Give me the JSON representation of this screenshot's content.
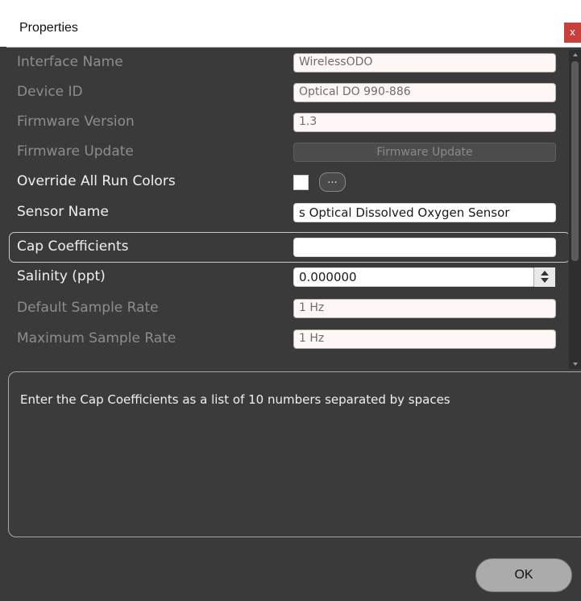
{
  "window": {
    "title": "Properties",
    "close_glyph": "x"
  },
  "properties": [
    {
      "label": "Interface Name",
      "value": "WirelessODO",
      "enabled": false,
      "type": "text"
    },
    {
      "label": "Device ID",
      "value": "Optical DO 990-886",
      "enabled": false,
      "type": "text"
    },
    {
      "label": "Firmware Version",
      "value": "1.3",
      "enabled": false,
      "type": "text"
    },
    {
      "label": "Firmware Update",
      "button_label": "Firmware Update",
      "enabled": false,
      "type": "button"
    },
    {
      "label": "Override All Run Colors",
      "checked": false,
      "button_label": "...",
      "enabled": true,
      "type": "checkbox"
    },
    {
      "label": "Sensor Name",
      "value": "s Optical Dissolved Oxygen Sensor",
      "enabled": true,
      "type": "text"
    },
    {
      "label": "Cap Coefficients",
      "value": "",
      "enabled": true,
      "type": "text",
      "selected": true
    },
    {
      "label": "Salinity (ppt)",
      "value": "0.000000",
      "enabled": true,
      "type": "spinner"
    },
    {
      "label": "Default Sample Rate",
      "value": "1 Hz",
      "enabled": false,
      "type": "text"
    },
    {
      "label": "Maximum Sample Rate",
      "value": "1 Hz",
      "enabled": false,
      "type": "text"
    }
  ],
  "description": "Enter the Cap Coefficients as a list of 10 numbers separated by spaces",
  "footer": {
    "ok_label": "OK"
  },
  "icons": {
    "close": "close-icon",
    "spinner_up": "chevron-up-icon",
    "spinner_down": "chevron-down-icon"
  },
  "colors": {
    "background": "#3a3a3a",
    "close_button": "#c9403a",
    "disabled_text": "#8d8d8d",
    "enabled_text": "#f0f0f0"
  }
}
